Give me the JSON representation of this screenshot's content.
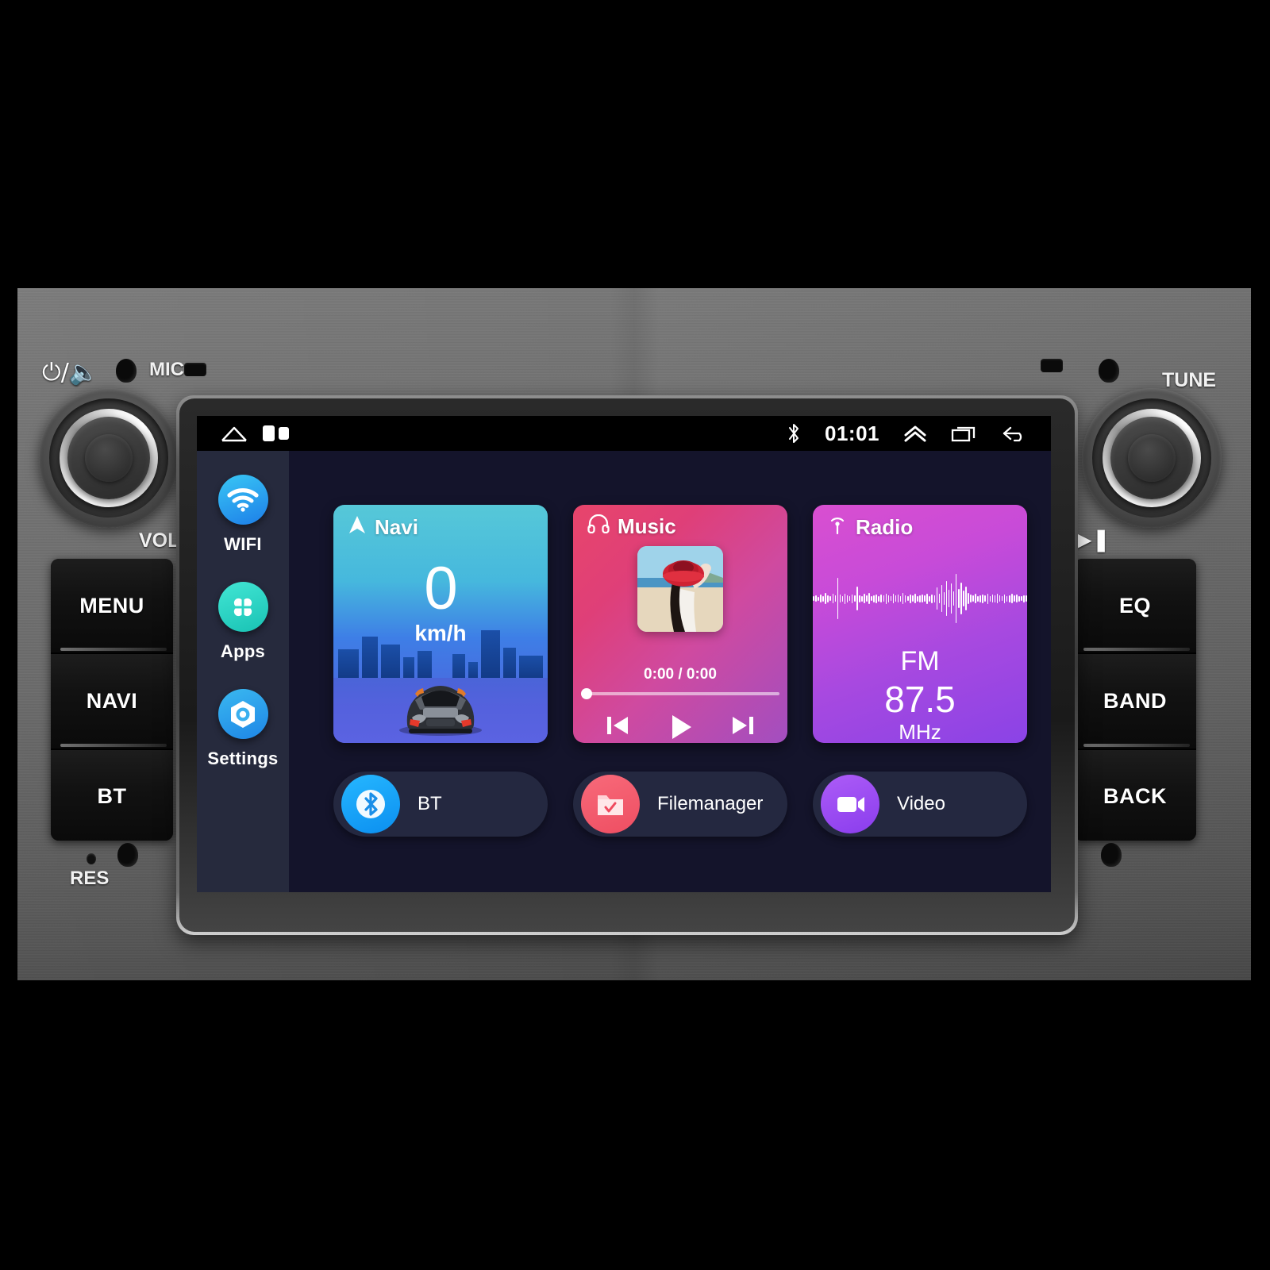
{
  "device": {
    "labels": {
      "vol": "VOL",
      "tune": "TUNE",
      "mic": "MIC",
      "res": "RES",
      "power_icon": "power-volume-icon",
      "playpause_icon": "play-pause-icon"
    },
    "left_buttons": [
      {
        "label": "MENU",
        "name": "hw-button-menu"
      },
      {
        "label": "NAVI",
        "name": "hw-button-navi"
      },
      {
        "label": "BT",
        "name": "hw-button-bt"
      }
    ],
    "right_buttons": [
      {
        "label": "EQ",
        "name": "hw-button-eq"
      },
      {
        "label": "BAND",
        "name": "hw-button-band"
      },
      {
        "label": "BACK",
        "name": "hw-button-back"
      }
    ],
    "knobs": [
      {
        "name": "volume-knob",
        "label": "VOL"
      },
      {
        "name": "tune-knob",
        "label": "TUNE"
      }
    ]
  },
  "statusbar": {
    "home_icon": "home-icon",
    "recents_icon": "split-screen-icon",
    "bluetooth_icon": "bluetooth-icon",
    "clock": "01:01",
    "expand_icon": "chevron-up-icon",
    "overview_icon": "recents-square-icon",
    "back_icon": "back-arrow-icon"
  },
  "sidebar": {
    "items": [
      {
        "label": "WIFI",
        "icon": "wifi-icon",
        "color": "#2f9ef0"
      },
      {
        "label": "Apps",
        "icon": "apps-grid-icon",
        "color": "#2dd4c4"
      },
      {
        "label": "Settings",
        "icon": "settings-hex-icon",
        "color": "#2b98ec"
      }
    ]
  },
  "cards": {
    "navi": {
      "title": "Navi",
      "icon": "navigation-arrow-icon",
      "speed_value": "0",
      "speed_unit": "km/h"
    },
    "music": {
      "title": "Music",
      "icon": "headphones-icon",
      "time": "0:00 / 0:00",
      "progress_percent": 0,
      "prev_icon": "skip-previous-icon",
      "play_icon": "play-icon",
      "next_icon": "skip-next-icon",
      "album_art": "woman-red-hat-beach"
    },
    "radio": {
      "title": "Radio",
      "icon": "radio-broadcast-icon",
      "band": "FM",
      "frequency": "87.5",
      "unit": "MHz"
    }
  },
  "shortcuts": [
    {
      "label": "BT",
      "icon": "bluetooth-icon",
      "color": "#0b8ff0"
    },
    {
      "label": "Filemanager",
      "icon": "folder-check-icon",
      "color": "#ee4e62"
    },
    {
      "label": "Video",
      "icon": "video-camera-icon",
      "color": "#8a3ded"
    }
  ],
  "colors": {
    "screen_bg": "#14142b",
    "sidebar_bg": "#262a3d",
    "shortcut_bg": "#242840",
    "navi_accent": "#46b8dd",
    "music_accent": "#df3f78",
    "radio_accent": "#a749e0"
  }
}
